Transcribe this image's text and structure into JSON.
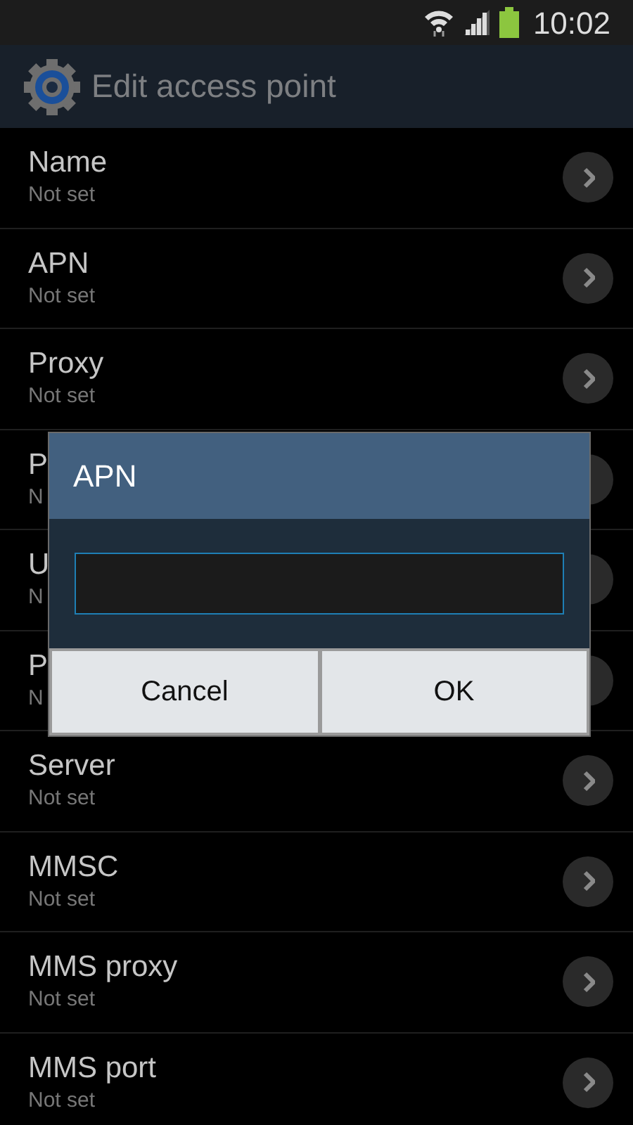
{
  "status_bar": {
    "time": "10:02"
  },
  "header": {
    "title": "Edit access point"
  },
  "settings": [
    {
      "title": "Name",
      "value": "Not set"
    },
    {
      "title": "APN",
      "value": "Not set"
    },
    {
      "title": "Proxy",
      "value": "Not set"
    },
    {
      "title": "P",
      "value": "N",
      "covered": true
    },
    {
      "title": "U",
      "value": "N",
      "covered": true
    },
    {
      "title": "P",
      "value": "N",
      "covered": true
    },
    {
      "title": "Server",
      "value": "Not set"
    },
    {
      "title": "MMSC",
      "value": "Not set"
    },
    {
      "title": "MMS proxy",
      "value": "Not set"
    },
    {
      "title": "MMS port",
      "value": "Not set"
    }
  ],
  "dialog": {
    "title": "APN",
    "buttons": [
      "Cancel",
      "OK"
    ]
  }
}
